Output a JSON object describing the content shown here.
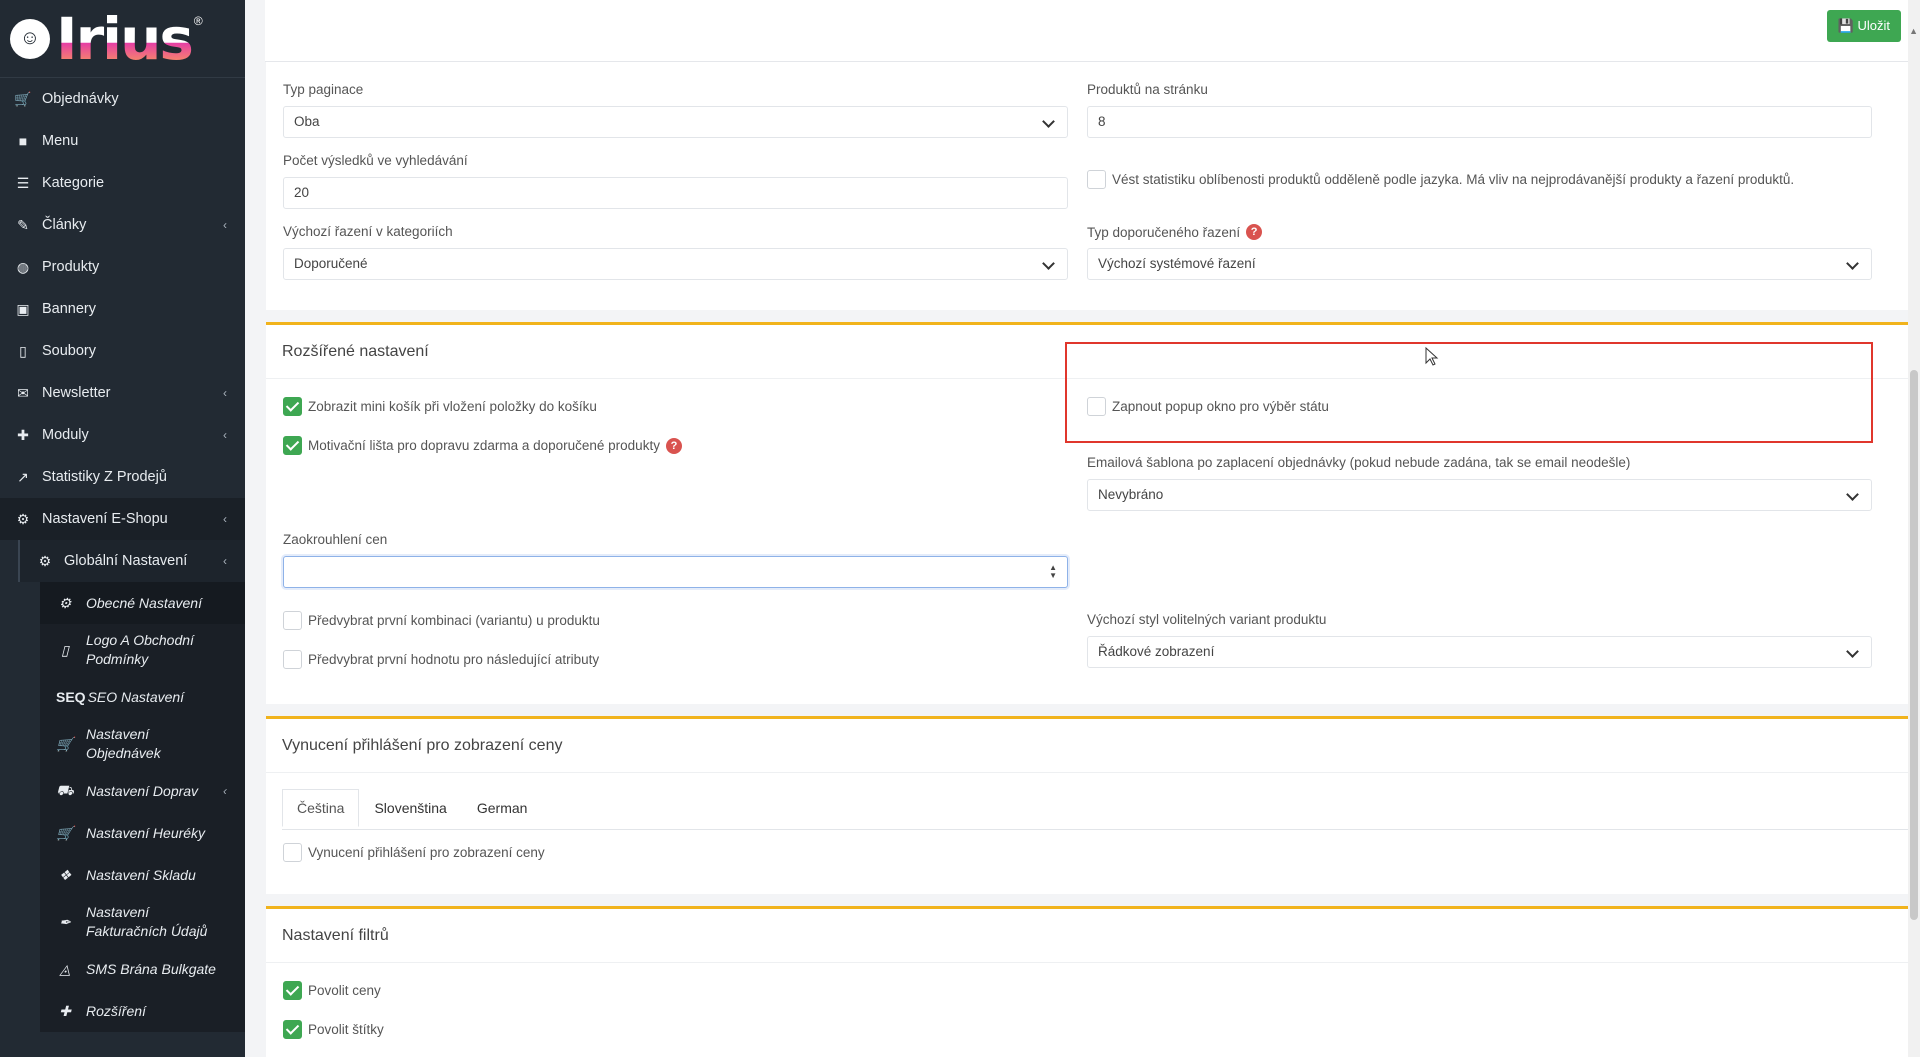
{
  "brand": {
    "logo_text": "Irius",
    "reg": "®"
  },
  "sidebar": {
    "items": [
      {
        "label": "Objednávky",
        "icon": "cart-icon",
        "arrow": ""
      },
      {
        "label": "Menu",
        "icon": "folder-icon",
        "arrow": ""
      },
      {
        "label": "Kategorie",
        "icon": "list-icon",
        "arrow": ""
      },
      {
        "label": "Články",
        "icon": "pencil-icon",
        "arrow": "‹"
      },
      {
        "label": "Produkty",
        "icon": "basketball-icon",
        "arrow": ""
      },
      {
        "label": "Bannery",
        "icon": "image-icon",
        "arrow": ""
      },
      {
        "label": "Soubory",
        "icon": "file-icon",
        "arrow": ""
      },
      {
        "label": "Newsletter",
        "icon": "mail-icon",
        "arrow": "‹"
      },
      {
        "label": "Moduly",
        "icon": "puzzle-icon",
        "arrow": "‹"
      },
      {
        "label": "Statistiky Z Prodejů",
        "icon": "chart-icon",
        "arrow": ""
      },
      {
        "label": "Nastavení E-Shopu",
        "icon": "cogs-icon",
        "arrow": "‹"
      }
    ],
    "sub1": {
      "label": "Globální Nastavení",
      "arrow": "‹"
    },
    "sub2": [
      {
        "label": "Obecné Nastavení",
        "icon": "gear-icon"
      },
      {
        "label": "Logo A Obchodní Podmínky",
        "icon": "file-icon"
      },
      {
        "label": "SEO Nastavení",
        "icon": "seo-icon",
        "prefix": "SEQ"
      },
      {
        "label": "Nastavení Objednávek",
        "icon": "cart-icon"
      },
      {
        "label": "Nastavení Doprav",
        "icon": "truck-icon",
        "arrow": "‹"
      },
      {
        "label": "Nastavení Heuréky",
        "icon": "cart-icon"
      },
      {
        "label": "Nastavení Skladu",
        "icon": "dropbox-icon"
      },
      {
        "label": "Nastavení Fakturačních Údajů",
        "icon": "feather-icon"
      },
      {
        "label": "SMS Brána Bulkgate",
        "icon": "wifi-icon"
      },
      {
        "label": "Rozšíření",
        "icon": "puzzle-icon"
      }
    ]
  },
  "toolbar": {
    "save_label": "Uložit"
  },
  "general": {
    "typ_paginace_label": "Typ paginace",
    "typ_paginace_value": "Oba",
    "produktu_label": "Produktů na stránku",
    "produktu_value": "8",
    "pocet_label": "Počet výsledků ve vyhledávání",
    "pocet_value": "20",
    "statistika_label": "Vést statistiku oblíbenosti produktů odděleně podle jazyka. Má vliv na nejprodávanější produkty a řazení produktů.",
    "razeni_label": "Výchozí řazení v kategoriích",
    "razeni_value": "Doporučené",
    "typ_dop_label": "Typ doporučeného řazení",
    "typ_dop_value": "Výchozí systémové řazení"
  },
  "advanced": {
    "title": "Rozšířené nastavení",
    "mini_kosik": "Zobrazit mini košík při vložení položky do košíku",
    "motivacni": "Motivační lišta pro dopravu zdarma a doporučené produkty",
    "popup": "Zapnout popup okno pro výběr státu",
    "email_label": "Emailová šablona po zaplacení objednávky (pokud nebude zadána, tak se email neodešle)",
    "email_value": "Nevybráno",
    "zaokrouhleni_label": "Zaokrouhlení cen",
    "zaokrouhleni_value": "",
    "predvybrat_kombinaci": "Předvybrat první kombinaci (variantu) u produktu",
    "predvybrat_hodnotu": "Předvybrat první hodnotu pro následující atributy",
    "styl_label": "Výchozí styl volitelných variant produktu",
    "styl_value": "Řádkové zobrazení"
  },
  "login": {
    "title": "Vynucení přihlášení pro zobrazení ceny",
    "tabs": [
      "Čeština",
      "Slovenština",
      "German"
    ],
    "checkbox": "Vynucení přihlášení pro zobrazení ceny"
  },
  "filters": {
    "title": "Nastavení filtrů",
    "ceny": "Povolit ceny",
    "stitky": "Povolit štítky"
  },
  "colors": {
    "accent": "#f1b31c",
    "green": "#3ea752",
    "highlight": "#e0362c",
    "sidebar": "#222a33"
  }
}
